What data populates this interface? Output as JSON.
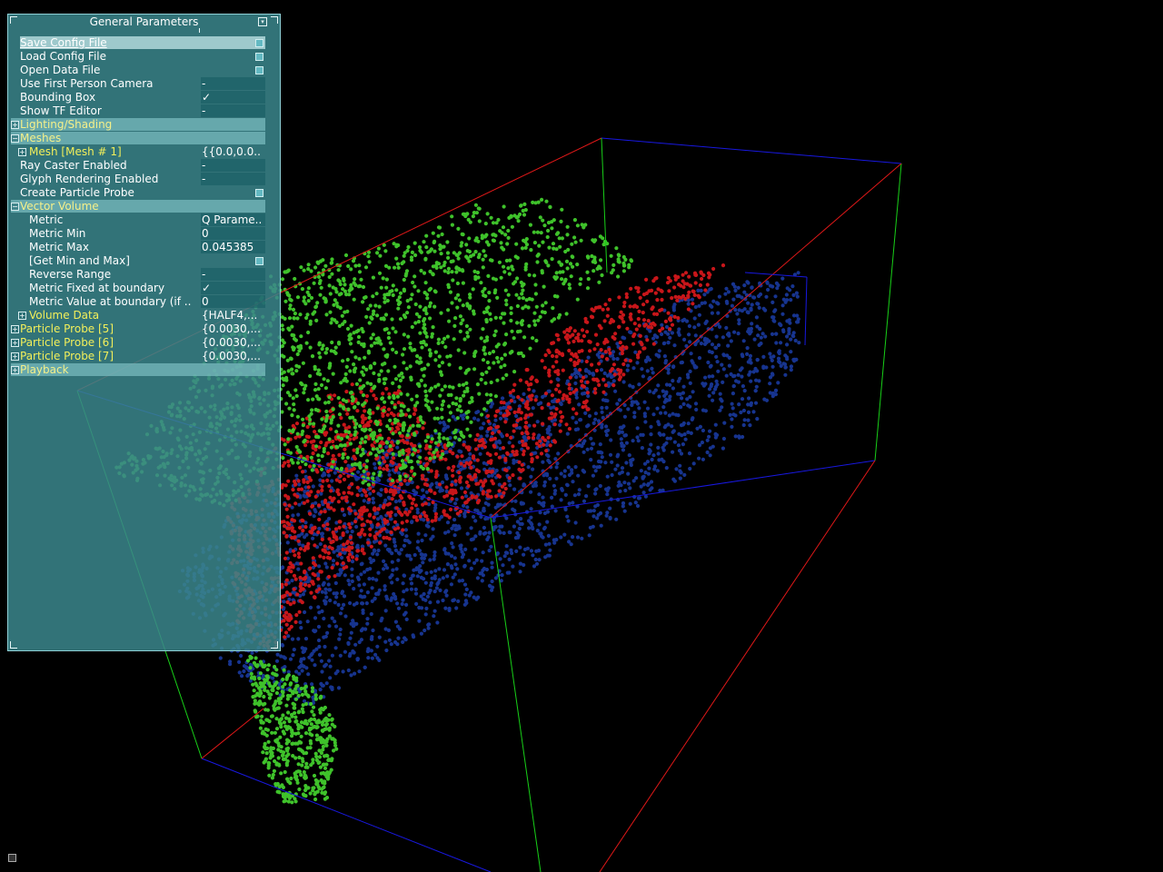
{
  "panel": {
    "title": "General Parameters",
    "rows": [
      {
        "label": "Save Config File",
        "type": "button",
        "indent": 0
      },
      {
        "label": "Load Config File",
        "type": "button",
        "indent": 0
      },
      {
        "label": "Open Data File",
        "type": "button",
        "indent": 0
      },
      {
        "label": "Use First Person Camera",
        "type": "toggle",
        "value": "-",
        "indent": 0
      },
      {
        "label": "Bounding Box",
        "type": "toggle",
        "value": "✓",
        "indent": 0
      },
      {
        "label": "Show TF Editor",
        "type": "toggle",
        "value": "-",
        "indent": 0
      },
      {
        "label": "Lighting/Shading",
        "type": "group",
        "expander": "+",
        "indent": 0
      },
      {
        "label": "Meshes",
        "type": "group",
        "expander": "−",
        "indent": 0
      },
      {
        "label": "Mesh [Mesh # 1]",
        "type": "subgroup",
        "expander": "+",
        "value": "{{0.0,0.0..",
        "indent": 1
      },
      {
        "label": "Ray Caster Enabled",
        "type": "toggle",
        "value": "-",
        "indent": 0
      },
      {
        "label": "Glyph Rendering Enabled",
        "type": "toggle",
        "value": "-",
        "indent": 0
      },
      {
        "label": "Create Particle Probe",
        "type": "button",
        "indent": 0
      },
      {
        "label": "Vector Volume",
        "type": "group",
        "expander": "−",
        "indent": 0
      },
      {
        "label": "Metric",
        "type": "field",
        "value": "Q Parame..",
        "indent": 1
      },
      {
        "label": "Metric Min",
        "type": "field",
        "value": "0",
        "indent": 1
      },
      {
        "label": "Metric Max",
        "type": "field",
        "value": "0.045385",
        "indent": 1
      },
      {
        "label": "[Get Min and Max]",
        "type": "button",
        "indent": 1
      },
      {
        "label": "Reverse Range",
        "type": "toggle",
        "value": "-",
        "indent": 1
      },
      {
        "label": "Metric Fixed at boundary",
        "type": "toggle",
        "value": "✓",
        "indent": 1
      },
      {
        "label": "Metric Value at boundary (if ..",
        "type": "field",
        "value": "0",
        "indent": 1
      },
      {
        "label": "Volume Data",
        "type": "subgroup",
        "expander": "+",
        "value": "{HALF4,...",
        "indent": 1
      },
      {
        "label": "Particle Probe [5]",
        "type": "subgroup",
        "expander": "+",
        "value": "{0.0030,...",
        "indent": 0
      },
      {
        "label": "Particle Probe [6]",
        "type": "subgroup",
        "expander": "+",
        "value": "{0.0030,...",
        "indent": 0
      },
      {
        "label": "Particle Probe [7]",
        "type": "subgroup",
        "expander": "+",
        "value": "{0.0030,...",
        "indent": 0
      },
      {
        "label": "Playback",
        "type": "group",
        "expander": "+",
        "indent": 0
      }
    ]
  },
  "scene": {
    "colors": {
      "green": "#3fc22b",
      "red": "#c8161a",
      "blue": "#17348f",
      "box_red": "#e01818",
      "box_green": "#18d018",
      "box_blue": "#1818e0"
    }
  }
}
